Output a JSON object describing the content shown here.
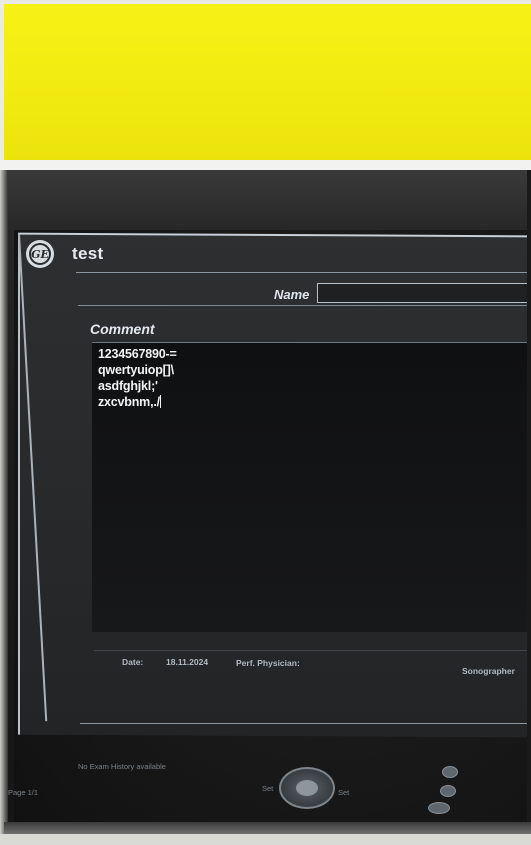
{
  "dialog": {
    "title": "test",
    "logo_text": "GE"
  },
  "form": {
    "name_label": "Name",
    "name_value": "",
    "comment_label": "Comment",
    "comment_lines": [
      "1234567890-=",
      "qwertyuiop[]\\",
      "asdfghjkl;'",
      "zxcvbnm,./"
    ]
  },
  "footer": {
    "date_label": "Date:",
    "date_value": "18.11.2024",
    "physician_label": "Perf. Physician:",
    "sonographer_label": "Sonographer"
  },
  "status": {
    "exam_history": "No Exam History available",
    "page": "Page 1/1",
    "set_left": "Set",
    "set_right": "Set"
  },
  "colors": {
    "yellow": "#f3ec12",
    "screen_bg": "#1a1a1a",
    "text": "#f2f4f6"
  }
}
